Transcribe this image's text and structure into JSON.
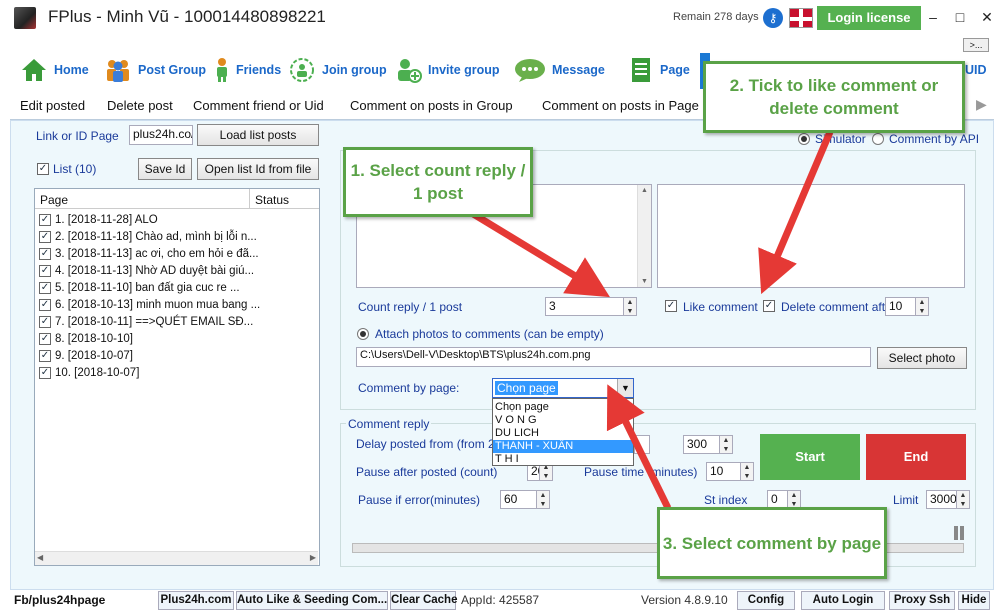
{
  "titlebar": {
    "title": "FPlus - Minh Vũ - 100014480898221",
    "remain": "Remain 278 days",
    "login_label": "Login license",
    "min": "–",
    "max": "□",
    "close": "✕",
    "more": ">..."
  },
  "nav": {
    "items": [
      {
        "label": "Home",
        "icon": "home-icon"
      },
      {
        "label": "Post Group",
        "icon": "group-icon"
      },
      {
        "label": "Friends",
        "icon": "friends-icon"
      },
      {
        "label": "Join group",
        "icon": "join-group-icon"
      },
      {
        "label": "Invite group",
        "icon": "invite-icon"
      },
      {
        "label": "Message",
        "icon": "message-icon"
      },
      {
        "label": "Page",
        "icon": "page-icon"
      }
    ],
    "uid": "UID"
  },
  "tabs": [
    "Edit posted",
    "Delete post",
    "Comment friend or Uid",
    "Comment on posts in Group",
    "Comment on posts in Page"
  ],
  "left": {
    "link_label": "Link or ID Page",
    "link_value": "plus24h.co/",
    "load_button": "Load list posts",
    "list_label": "List (10)",
    "save_id": "Save Id",
    "open_list": "Open list Id from file",
    "col_page": "Page",
    "col_status": "Status",
    "rows": [
      "1. [2018-11-28] ALO",
      "2. [2018-11-18] Chào ad, mình bị lỗi n...",
      "3. [2018-11-13] ac ơi, cho em hỏi e đã...",
      "4. [2018-11-13] Nhờ AD duyệt bài giú...",
      "5. [2018-11-10] ban đất  gia cuc re       ...",
      "6. [2018-10-13] minh muon mua bang ...",
      "7. [2018-10-11] ==>QUÉT EMAIL SĐ...",
      "8. [2018-10-10]",
      "9. [2018-10-07]",
      "10. [2018-10-07]"
    ]
  },
  "right": {
    "simulator": "Simulator",
    "comment_api": "Comment by API",
    "count_reply_label": "Count reply / 1 post",
    "count_reply_value": "3",
    "like_comment": "Like comment",
    "delete_comment": "Delete comment after(",
    "delete_value": "10",
    "attach_label": "Attach photos to comments (can be empty)",
    "photo_path": "C:\\Users\\Dell-V\\Desktop\\BTS\\plus24h.com.png",
    "select_photo": "Select photo",
    "comment_by_page_label": "Comment by page:",
    "dropdown_selected": "Chọn page",
    "dropdown_options": [
      "Chọn page",
      "V O N G",
      "DU LICH",
      "THANH - XUÂN",
      "T H I"
    ],
    "reply_group_title": "Comment reply",
    "delay_label": "Delay posted from (from 200 (",
    "delay_value": "300",
    "pause_after_label": "Pause after posted (count)",
    "pause_after_value": "20",
    "pause_time_label": "Pause time (minutes)",
    "pause_time_value": "10",
    "pause_error_label": "Pause if error(minutes)",
    "pause_error_value": "60",
    "start_index_label": "St  index",
    "start_index_value": "0",
    "limit_label": "Limit",
    "limit_value": "3000",
    "start": "Start",
    "end": "End"
  },
  "callouts": {
    "c1": "1. Select count reply / 1 post",
    "c2": "2. Tick to like comment or delete comment",
    "c3": "3. Select comment by page"
  },
  "statusbar": {
    "fb": "Fb/plus24hpage",
    "site": "Plus24h.com",
    "auto_like": "Auto Like & Seeding Com...",
    "clear_cache": "Clear Cache",
    "appid": "AppId: 425587",
    "version": "Version 4.8.9.10",
    "config": "Config",
    "auto_login": "Auto Login",
    "proxy": "Proxy Ssh",
    "hide": "Hide"
  },
  "colors": {
    "accent": "#55b150",
    "danger": "#d83535",
    "nav": "#1b68c9",
    "callout": "#5aa247",
    "arrow": "#e53935"
  }
}
